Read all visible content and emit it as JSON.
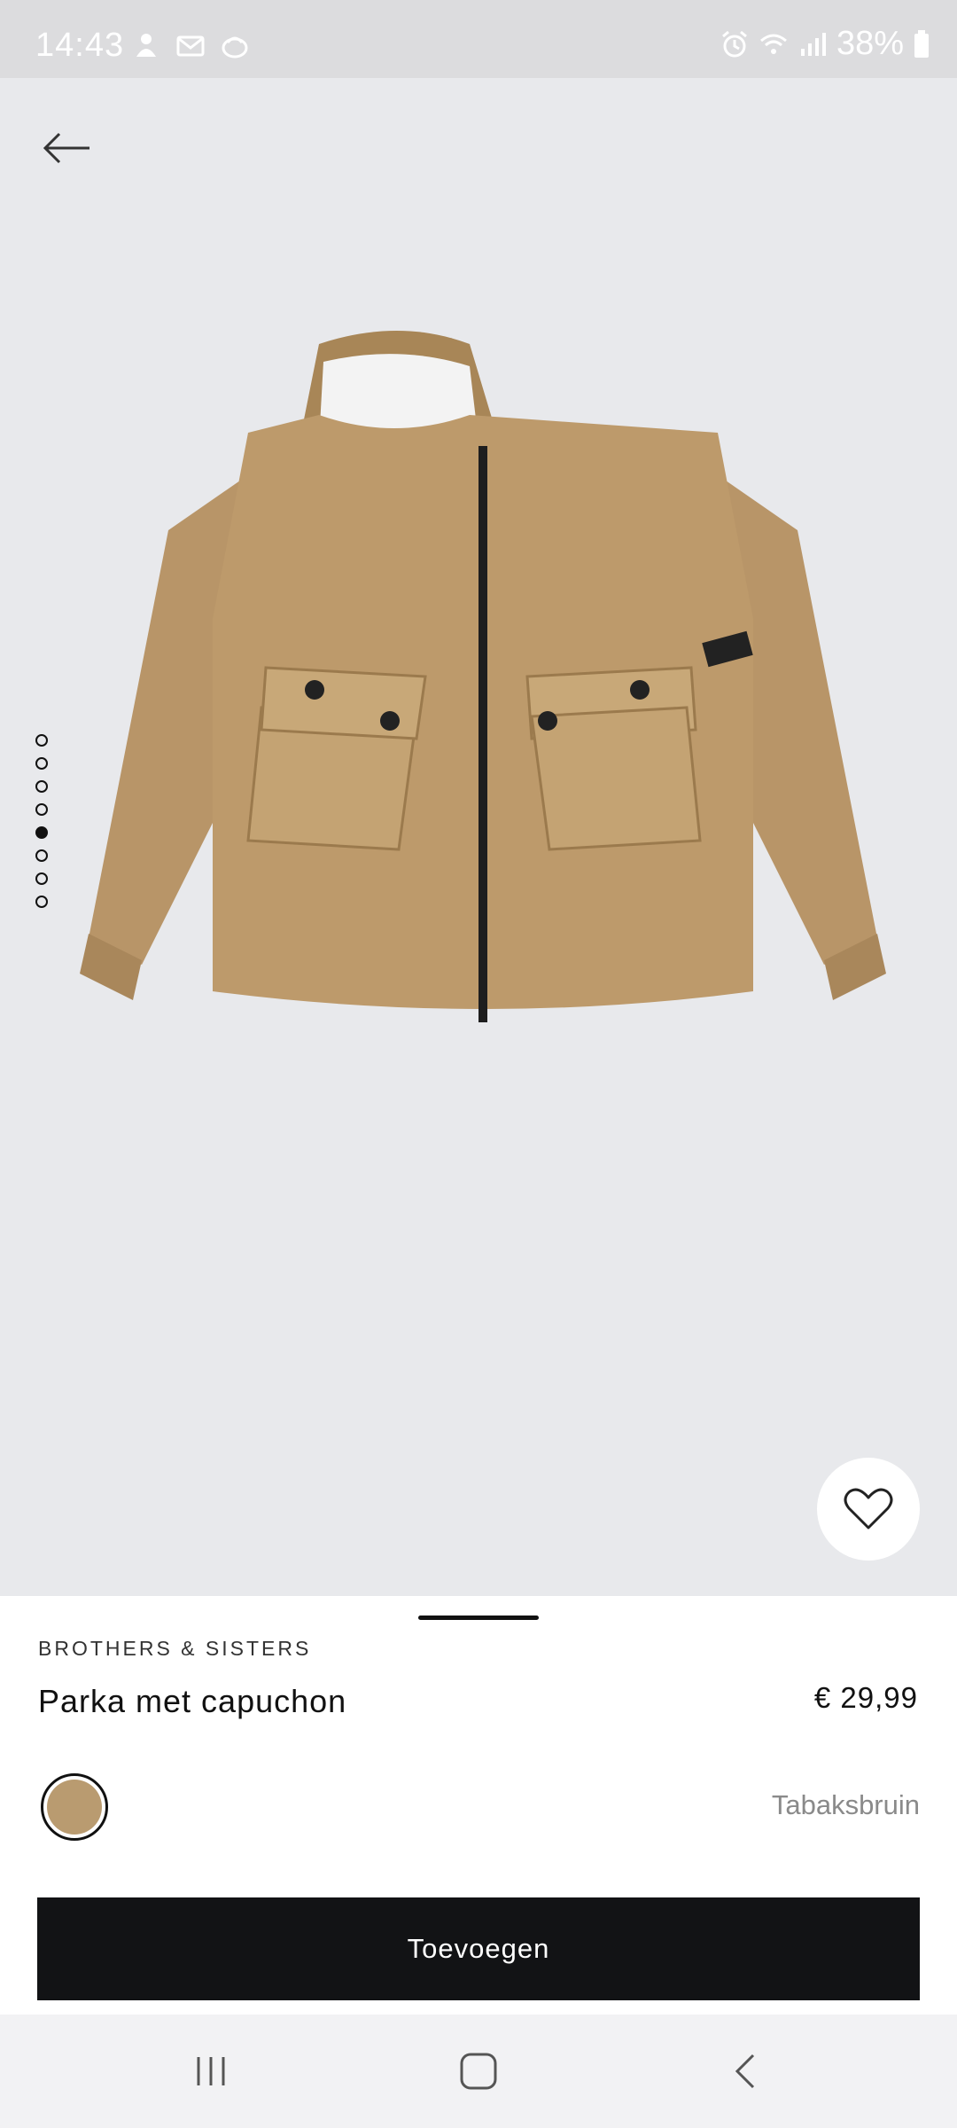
{
  "status_bar": {
    "time": "14:43",
    "battery_percent": "38%",
    "left_icons": [
      "notification-icon",
      "mail-icon",
      "app-icon"
    ],
    "right_icons": [
      "alarm-icon",
      "wifi-icon",
      "signal-icon",
      "battery-icon"
    ]
  },
  "gallery": {
    "image_count": 8,
    "active_index": 4,
    "image_alt": "Parka met capuchon"
  },
  "product": {
    "brand": "BROTHERS & SISTERS",
    "name": "Parka met capuchon",
    "price": "€ 29,99",
    "color_name": "Tabaksbruin",
    "swatch_color": "#b99b70"
  },
  "actions": {
    "add_label": "Toevoegen"
  },
  "colors": {
    "background": "#e8e9ec",
    "button": "#121315"
  }
}
